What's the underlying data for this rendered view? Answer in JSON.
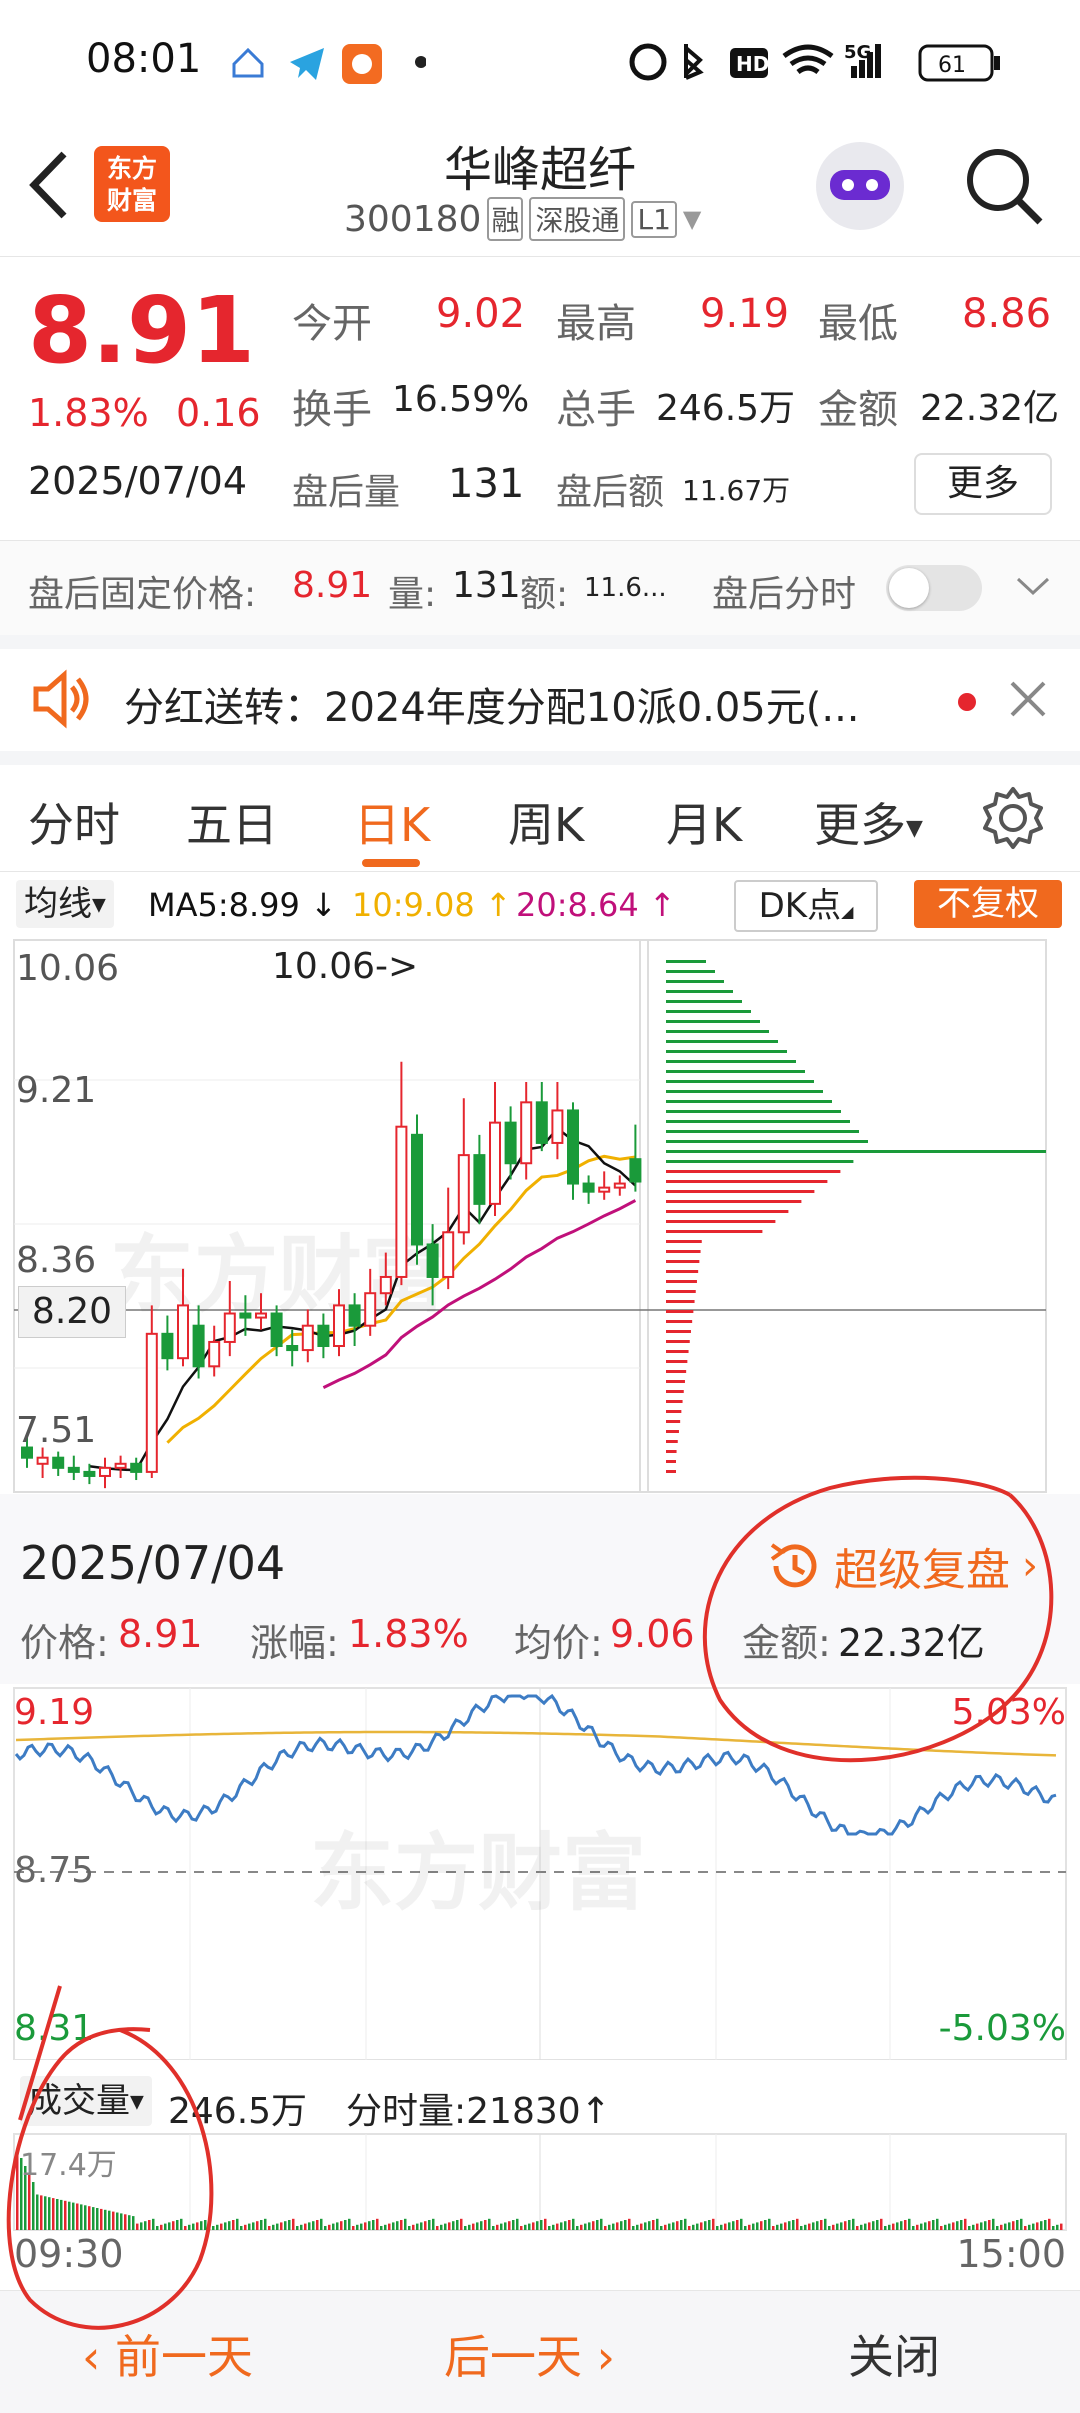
{
  "status_bar": {
    "time": "08:01",
    "battery": "61"
  },
  "header": {
    "logo_line1": "东方",
    "logo_line2": "财富",
    "stock_name": "华峰超纤",
    "stock_code": "300180",
    "tag_margin": "融",
    "tag_connect": "深股通",
    "tag_level": "L1"
  },
  "quote": {
    "price": "8.91",
    "change_pct": "1.83%",
    "change_amt": "0.16",
    "date": "2025/07/04",
    "open_label": "今开",
    "open": "9.02",
    "high_label": "最高",
    "high": "9.19",
    "low_label": "最低",
    "low": "8.86",
    "turnover_label": "换手",
    "turnover": "16.59%",
    "volume_label": "总手",
    "volume": "246.5万",
    "amount_label": "金额",
    "amount": "22.32亿",
    "after_vol_label": "盘后量",
    "after_vol": "131",
    "after_amt_label": "盘后额",
    "after_amt": "11.67万",
    "more_button": "更多"
  },
  "after_hours": {
    "fixed_price_label": "盘后固定价格:",
    "fixed_price": "8.91",
    "vol_label": "量:",
    "vol": "131",
    "amt_label": "额:",
    "amt": "11.6...",
    "toggle_label": "盘后分时"
  },
  "notice": {
    "text": "分红送转：2024年度分配10派0.05元(..."
  },
  "tabs": [
    "分时",
    "五日",
    "日K",
    "周K",
    "月K",
    "更多"
  ],
  "active_tab": "日K",
  "ma_bar": {
    "selector": "均线",
    "ma5": "MA5:8.99",
    "ma10": "10:9.08",
    "ma20": "20:8.64",
    "dk_button": "DK点",
    "adjust_button": "不复权"
  },
  "kline": {
    "y_labels": [
      "10.06",
      "9.21",
      "8.36",
      "7.51"
    ],
    "max_annotation": "10.06->",
    "crosshair_price": "8.20",
    "watermark": "东方财富"
  },
  "detail": {
    "date": "2025/07/04",
    "review_button": "超级复盘",
    "price_label": "价格:",
    "price": "8.91",
    "change_label": "涨幅:",
    "change": "1.83%",
    "avg_label": "均价:",
    "avg": "9.06",
    "amount_label": "金额:",
    "amount": "22.32亿"
  },
  "intraday": {
    "top_price": "9.19",
    "mid_price": "8.75",
    "low_price": "8.31",
    "top_pct": "5.03%",
    "low_pct": "-5.03%",
    "watermark": "东方财富"
  },
  "volume_section": {
    "selector": "成交量",
    "total": "246.5万",
    "tick_label": "分时量:21830",
    "max_label": "17.4万",
    "start_time": "09:30",
    "end_time": "15:00"
  },
  "bottom_nav": {
    "prev": "前一天",
    "next": "后一天",
    "close": "关闭"
  },
  "colors": {
    "up": "#e5262e",
    "down": "#1a9a3a",
    "accent": "#f0691e",
    "ma5": "#111111",
    "ma10": "#f0b000",
    "ma20": "#c0107a"
  }
}
